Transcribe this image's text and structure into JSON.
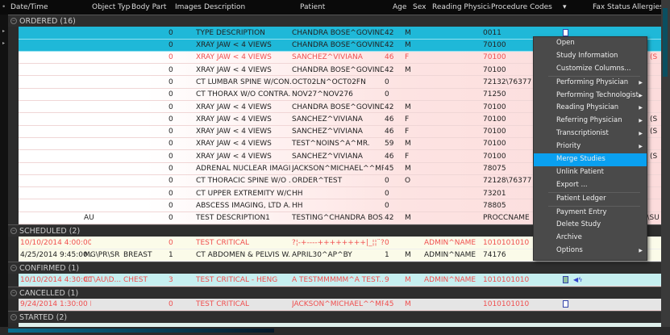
{
  "columns": [
    "Date/Time",
    "Object Type",
    "Body Part",
    "Images",
    "Description",
    "Patient",
    "Age",
    "Sex",
    "Reading Physician",
    "Procedure Codes",
    "Fax Status",
    "Allergies"
  ],
  "colors": {
    "selected": "#1fb8d8",
    "critical_text": "#f04f4f",
    "menu_highlight": "#0aa0f0"
  },
  "groups": [
    {
      "label": "ORDERED (16)",
      "kind": "ord",
      "rows": [
        {
          "sel": true,
          "img": "0",
          "desc": "TYPE DESCRIPTION",
          "pat": "CHANDRA BOSE^GOVIND...",
          "age": "42",
          "sex": "M",
          "proc": "0011",
          "icon": "document-icon"
        },
        {
          "sel": true,
          "img": "0",
          "desc": "XRAY JAW < 4 VIEWS",
          "pat": "CHANDRA BOSE^GOVIND...",
          "age": "42",
          "sex": "M",
          "proc": "70100"
        },
        {
          "red": true,
          "img": "0",
          "desc": "XRAY JAW < 4 VIEWS",
          "pat": "SANCHEZ^VIVIANA",
          "age": "46",
          "sex": "F",
          "proc": "70100",
          "all": "A (S"
        },
        {
          "img": "0",
          "desc": "XRAY JAW < 4 VIEWS",
          "pat": "CHANDRA BOSE^GOVIND...",
          "age": "42",
          "sex": "M",
          "proc": "70100"
        },
        {
          "img": "0",
          "desc": "CT LUMBAR SPINE W/CON...",
          "pat": "OCT02LN^OCT02FN",
          "age": "0",
          "proc": "72132\\76377"
        },
        {
          "img": "0",
          "desc": "CT THORAX W/O CONTRA...",
          "pat": "NOV27^NOV276",
          "age": "0",
          "proc": "71250"
        },
        {
          "img": "0",
          "desc": "XRAY JAW < 4 VIEWS",
          "pat": "CHANDRA BOSE^GOVIND...",
          "age": "42",
          "sex": "M",
          "proc": "70100"
        },
        {
          "img": "0",
          "desc": "XRAY JAW < 4 VIEWS",
          "pat": "SANCHEZ^VIVIANA",
          "age": "46",
          "sex": "F",
          "proc": "70100",
          "all": "A (S"
        },
        {
          "img": "0",
          "desc": "XRAY JAW < 4 VIEWS",
          "pat": "SANCHEZ^VIVIANA",
          "age": "46",
          "sex": "F",
          "proc": "70100",
          "all": "A (S"
        },
        {
          "img": "0",
          "desc": "XRAY JAW < 4 VIEWS",
          "pat": "TEST^NOINS^A^MR.",
          "age": "59",
          "sex": "M",
          "proc": "70100"
        },
        {
          "img": "0",
          "desc": "XRAY JAW < 4 VIEWS",
          "pat": "SANCHEZ^VIVIANA",
          "age": "46",
          "sex": "F",
          "proc": "70100",
          "all": "A (S"
        },
        {
          "img": "0",
          "desc": "ADRENAL NUCLEAR IMAGI...",
          "pat": "JACKSON^MICHAEL^^MR.",
          "age": "45",
          "sex": "M",
          "proc": "78075"
        },
        {
          "img": "0",
          "desc": "CT THORACIC SPINE W/O ...",
          "pat": "ORDER^TEST",
          "age": "0",
          "sex": "O",
          "proc": "72128\\76377"
        },
        {
          "img": "0",
          "desc": "CT UPPER EXTREMITY W/C...",
          "pat": "HH",
          "age": "0",
          "proc": "73201"
        },
        {
          "img": "0",
          "desc": "ABSCESS IMAGING, LTD A...",
          "pat": "HH",
          "age": "0",
          "proc": "78805"
        },
        {
          "obj": "AU",
          "img": "0",
          "desc": "TEST DESCRIPTION1",
          "pat": "TESTING^CHANDRA BOS...",
          "age": "42",
          "sex": "M",
          "proc": "PROCCNAME",
          "all": "T\\SU"
        }
      ]
    },
    {
      "label": "SCHEDULED (2)",
      "kind": "sch",
      "rows": [
        {
          "red": true,
          "dt": "10/10/2014 4:00:00 ...",
          "img": "0",
          "desc": "TEST CRITICAL",
          "pat": "?¦-+----++++++++|_¦¦¨?8...",
          "age": "0",
          "rp": "ADMIN^NAME",
          "proc": "1010101010"
        },
        {
          "dt": "4/25/2014 9:45:00 A...",
          "obj": "MG\\PR\\SR",
          "bp": "BREAST",
          "img": "1",
          "desc": "CT ABDOMEN & PELVIS W...",
          "pat": "APRIL30^AP^BY",
          "age": "1",
          "sex": "M",
          "rp": "ADMIN^NAME",
          "proc": "74176"
        }
      ]
    },
    {
      "label": "CONFIRMED (1)",
      "kind": "con",
      "rows": [
        {
          "red": true,
          "dt": "10/10/2014 4:30:00 ...",
          "obj": "CT\\AU\\D...",
          "bp": "CHEST",
          "img": "3",
          "desc": "TEST CRITICAL - HENG",
          "pat": "A TESTMMMMM^A TEST...",
          "age": "9",
          "sex": "M",
          "rp": "ADMIN^NAME",
          "proc": "1010101010",
          "icon": "report-icon",
          "icon2": "audio-icon"
        }
      ]
    },
    {
      "label": "CANCELLED (1)",
      "kind": "can",
      "rows": [
        {
          "red": true,
          "dt": "9/24/2014 1:30:00 P...",
          "img": "0",
          "desc": "TEST CRITICAL",
          "pat": "JACKSON^MICHAEL^^MR.",
          "age": "45",
          "sex": "M",
          "proc": "1010101010",
          "icon": "document-icon"
        }
      ]
    },
    {
      "label": "STARTED (2)",
      "kind": "sta",
      "rows": [
        {
          "red": true
        }
      ]
    }
  ],
  "context_menu": {
    "items": [
      {
        "label": "Open"
      },
      {
        "label": "Study Information"
      },
      {
        "label": "Customize Columns..."
      },
      {
        "sep": true
      },
      {
        "label": "Performing Physician",
        "sub": true
      },
      {
        "label": "Performing Technologist",
        "sub": true
      },
      {
        "label": "Reading Physician",
        "sub": true
      },
      {
        "label": "Referring Physician",
        "sub": true
      },
      {
        "label": "Transcriptionist",
        "sub": true
      },
      {
        "label": "Priority",
        "sub": true
      },
      {
        "label": "Merge Studies",
        "hl": true
      },
      {
        "label": "Unlink Patient"
      },
      {
        "label": "Export ..."
      },
      {
        "sep": true
      },
      {
        "label": "Patient Ledger"
      },
      {
        "sep": true
      },
      {
        "label": "Payment Entry"
      },
      {
        "label": "Delete Study"
      },
      {
        "label": "Archive"
      },
      {
        "label": "Options",
        "sub": true
      }
    ]
  }
}
